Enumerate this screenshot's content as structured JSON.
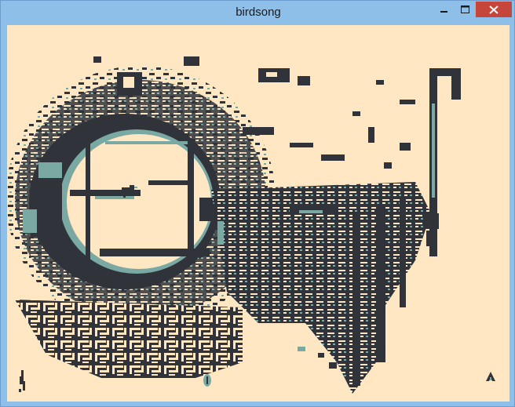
{
  "window": {
    "title": "birdsong",
    "controls": [
      "minimize-icon",
      "maximize-icon",
      "close-icon"
    ]
  },
  "palette": {
    "background": "#ffe7c4",
    "dark": "#30343a",
    "teal": "#7aa9a4",
    "titlebar": "#8ebfe9",
    "close": "#c7463b"
  },
  "game": {
    "player": "bird-sprite",
    "hud": {
      "left_icon": "bird-silhouette-icon",
      "center_icon": "seed-icon",
      "right_icon": "up-arrow-icon"
    }
  }
}
